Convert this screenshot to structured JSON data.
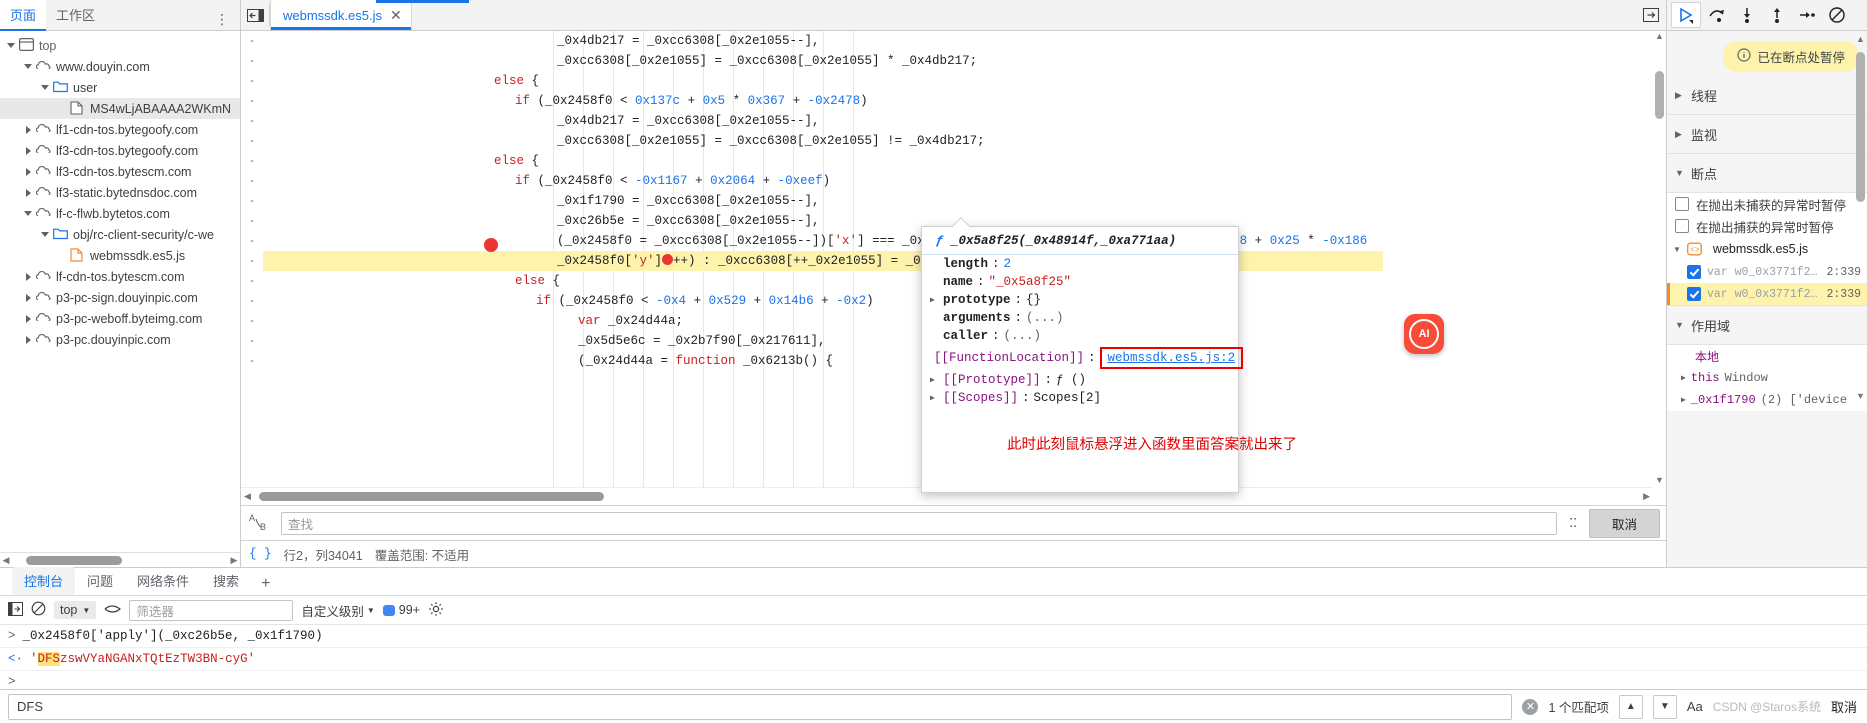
{
  "left_pane": {
    "tabs": [
      {
        "label": "页面",
        "active": true
      },
      {
        "label": "工作区",
        "active": false
      }
    ],
    "kebab": "⋮",
    "tree": [
      {
        "label": "top",
        "icon": "frame-icon",
        "indent": 0,
        "state": "open",
        "selected": false
      },
      {
        "label": "www.douyin.com",
        "icon": "cloud-icon",
        "indent": 1,
        "state": "open",
        "selected": false
      },
      {
        "label": "user",
        "icon": "folder-icon",
        "indent": 2,
        "state": "open",
        "selected": false
      },
      {
        "label": "MS4wLjABAAAA2WKmN",
        "icon": "doc-icon",
        "indent": 3,
        "state": "leaf",
        "selected": true
      },
      {
        "label": "lf1-cdn-tos.bytegoofy.com",
        "icon": "cloud-icon",
        "indent": 1,
        "state": "closed",
        "selected": false
      },
      {
        "label": "lf3-cdn-tos.bytegoofy.com",
        "icon": "cloud-icon",
        "indent": 1,
        "state": "closed",
        "selected": false
      },
      {
        "label": "lf3-cdn-tos.bytescm.com",
        "icon": "cloud-icon",
        "indent": 1,
        "state": "closed",
        "selected": false
      },
      {
        "label": "lf3-static.bytednsdoc.com",
        "icon": "cloud-icon",
        "indent": 1,
        "state": "closed",
        "selected": false
      },
      {
        "label": "lf-c-flwb.bytetos.com",
        "icon": "cloud-icon",
        "indent": 1,
        "state": "open",
        "selected": false
      },
      {
        "label": "obj/rc-client-security/c-we",
        "icon": "folder-icon",
        "indent": 2,
        "state": "open",
        "selected": false
      },
      {
        "label": "webmssdk.es5.js",
        "icon": "js-icon",
        "indent": 3,
        "state": "leaf",
        "selected": false
      },
      {
        "label": "lf-cdn-tos.bytescm.com",
        "icon": "cloud-icon",
        "indent": 1,
        "state": "closed",
        "selected": false
      },
      {
        "label": "p3-pc-sign.douyinpic.com",
        "icon": "cloud-icon",
        "indent": 1,
        "state": "closed",
        "selected": false
      },
      {
        "label": "p3-pc-weboff.byteimg.com",
        "icon": "cloud-icon",
        "indent": 1,
        "state": "closed",
        "selected": false
      },
      {
        "label": "p3-pc.douyinpic.com",
        "icon": "cloud-icon",
        "indent": 1,
        "state": "closed",
        "selected": false
      }
    ]
  },
  "center_pane": {
    "file_tab": {
      "label": "webmssdk.es5.js",
      "close": "✕"
    },
    "panel_toggle_icon": "show-navigator-icon",
    "more_tabs_icon": "more-tabs-icon",
    "code_lines": [
      {
        "indent": 14,
        "text": "_0x4db217 = _0xcc6308[_0x2e1055--],",
        "hl": false
      },
      {
        "indent": 14,
        "text": "_0xcc6308[_0x2e1055] = _0xcc6308[_0x2e1055] * _0x4db217;",
        "hl": false
      },
      {
        "indent": 11,
        "text": "else {",
        "hl": false
      },
      {
        "indent": 12,
        "text": "if (_0x2458f0 < 0x137c + 0x5 * 0x367 + -0x2478)",
        "hl": false
      },
      {
        "indent": 14,
        "text": "_0x4db217 = _0xcc6308[_0x2e1055--],",
        "hl": false
      },
      {
        "indent": 14,
        "text": "_0xcc6308[_0x2e1055] = _0xcc6308[_0x2e1055] != _0x4db217;",
        "hl": false
      },
      {
        "indent": 11,
        "text": "else {",
        "hl": false
      },
      {
        "indent": 12,
        "text": "if (_0x2458f0 < -0x1167 + 0x2064 + -0xeef)",
        "hl": false
      },
      {
        "indent": 14,
        "text": "_0x1f1790 = _0xcc6308[_0x2e1055--],",
        "hl": false
      },
      {
        "indent": 14,
        "text": "_0xc26b5e = _0xcc6308[_0x2e1055--],",
        "hl": false
      },
      {
        "indent": 14,
        "text": "(_0x2458f0 = _0xcc6308[_0x2e1055--])['x'] === _0x1218ef ? _0x2458f0['y'] >= _0x1ef7 + 0x1968 + 0x25 * -0x186",
        "hl": false
      },
      {
        "indent": 14,
        "text": "_0x2458f0['y']●++) : _0xcc6308[++_0x2e1055] = _0x2458f0['apply']=(_0xc26b5e, _0x1f1790);",
        "hl": true
      },
      {
        "indent": 12,
        "text": "else {",
        "hl": false
      },
      {
        "indent": 13,
        "text": "if (_0x2458f0 < -0x4 + 0x529 + 0x14b6 + -0x2)",
        "hl": false
      },
      {
        "indent": 15,
        "text": "var _0x24d44a;",
        "hl": false
      },
      {
        "indent": 15,
        "text": "_0x5d5e6c = _0x2b7f90[_0x217611],",
        "hl": false
      },
      {
        "indent": 15,
        "text": "(_0x24d44a = function _0x6213b() {",
        "hl": false
      }
    ],
    "find": {
      "icon": "replace-icon",
      "placeholder": "查找",
      "cancel_label": "取消",
      "dots": "⁚⁚"
    },
    "status": {
      "format_icon": "{ }",
      "position": "行2，列34041",
      "coverage": "覆盖范围: 不适用"
    }
  },
  "function_popup": {
    "signature_f": "ƒ",
    "signature": "_0x5a8f25(_0x48914f,_0xa771aa)",
    "rows": [
      {
        "key": "length",
        "sep": ":",
        "value": "2",
        "type": "num",
        "tri": false
      },
      {
        "key": "name",
        "sep": ":",
        "value": "\"_0x5a8f25\"",
        "type": "str",
        "tri": false
      },
      {
        "key": "prototype",
        "sep": ":",
        "value": "{}",
        "type": "obj",
        "tri": true
      },
      {
        "key": "arguments",
        "sep": ":",
        "value": "(...)",
        "type": "grey",
        "tri": false
      },
      {
        "key": "caller",
        "sep": ":",
        "value": "(...)",
        "type": "grey",
        "tri": false
      },
      {
        "key": "[[FunctionLocation]]",
        "sep": ":",
        "value": "webmssdk.es5.js:2",
        "type": "link",
        "tri": false
      },
      {
        "key": "[[Prototype]]",
        "sep": ":",
        "value": "ƒ ()",
        "type": "proto",
        "tri": true
      },
      {
        "key": "[[Scopes]]",
        "sep": ":",
        "value": "Scopes[2]",
        "type": "obj",
        "tri": true
      }
    ]
  },
  "annotation": {
    "text": "此时此刻鼠标悬浮进入函数里面答案就出来了",
    "color": "#e00000"
  },
  "right_pane": {
    "toolbar": [
      {
        "icon": "resume-icon",
        "selected": true
      },
      {
        "icon": "step-over-icon",
        "selected": false
      },
      {
        "icon": "step-into-icon",
        "selected": false
      },
      {
        "icon": "step-out-icon",
        "selected": false
      },
      {
        "icon": "step-icon",
        "selected": false
      },
      {
        "icon": "deactivate-breakpoints-icon",
        "selected": false
      }
    ],
    "paused_chip": {
      "icon": "info-icon",
      "label": "已在断点处暂停"
    },
    "sections": [
      {
        "label": "线程",
        "open": false
      },
      {
        "label": "监视",
        "open": false
      },
      {
        "label": "断点",
        "open": true
      }
    ],
    "breakpoint_options": [
      {
        "label": "在抛出未捕获的异常时暂停",
        "checked": false
      },
      {
        "label": "在抛出捕获的异常时暂停",
        "checked": false
      }
    ],
    "breakpoint_file": {
      "icon": "js-file-icon",
      "label": "webmssdk.es5.js",
      "open": true
    },
    "breakpoints": [
      {
        "checked": true,
        "text": "var w0_0x3771f2…",
        "loc": "2:339",
        "current": false
      },
      {
        "checked": true,
        "text": "var w0_0x3771f2…",
        "loc": "2:339",
        "current": true
      }
    ],
    "scope_section": {
      "label": "作用域",
      "open": true
    },
    "scope_rows": [
      {
        "key": "本地",
        "value": "",
        "tri": false
      },
      {
        "key": "this",
        "value": "Window",
        "tri": true
      },
      {
        "key": "_0x1f1790",
        "value": "(2) ['device",
        "tri": true
      }
    ],
    "ai_badge": "AI"
  },
  "console": {
    "tabs": [
      {
        "label": "控制台",
        "active": true
      },
      {
        "label": "问题",
        "active": false
      },
      {
        "label": "网络条件",
        "active": false
      },
      {
        "label": "搜索",
        "active": false
      }
    ],
    "plus": "+",
    "toolbar": {
      "sidebar_icon": "console-sidebar-icon",
      "clear_icon": "clear-console-icon",
      "context": "top",
      "eye_icon": "live-expression-icon",
      "filter_placeholder": "筛选器",
      "levels_label": "自定义级别",
      "issues_count": "99+",
      "settings_icon": "gear-icon"
    },
    "entries": [
      {
        "marker": ">",
        "kind": "input",
        "text": "_0x2458f0['apply'](_0xc26b5e, _0x1f1790)"
      },
      {
        "marker": "<·",
        "kind": "output",
        "highlight": "DFS",
        "text": "zswVYaNGANxTQtEzTW3BN-cyG",
        "quote": "'"
      },
      {
        "marker": ">",
        "kind": "prompt",
        "text": ""
      }
    ]
  },
  "bottom_find": {
    "value": "DFS",
    "clear_icon": "clear-icon",
    "count": "1 个匹配项",
    "prev_icon": "▲",
    "next_icon": "▼",
    "aa_label": "Aa",
    "watermark": "CSDN @Staros系统",
    "cancel_label": "取消"
  }
}
